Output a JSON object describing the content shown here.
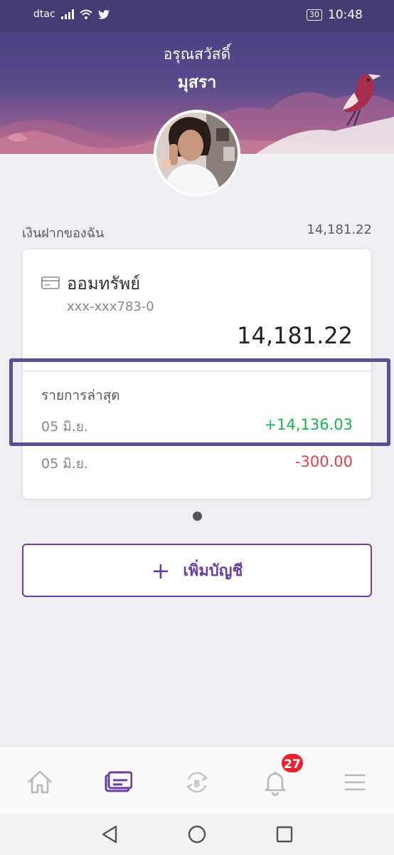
{
  "status_bar": {
    "carrier": "dtac",
    "battery": "30",
    "time": "10:48"
  },
  "header": {
    "greeting": "อรุณสวัสดิ์",
    "name": "มุสรา"
  },
  "deposits": {
    "label": "เงินฝากของฉัน",
    "total": "14,181.22"
  },
  "account": {
    "name": "ออมทรัพย์",
    "number": "xxx-xxx783-0",
    "balance": "14,181.22",
    "recent_label": "รายการล่าสุด",
    "transactions": [
      {
        "date": "05 มิ.ย.",
        "amount": "+14,136.03",
        "type": "credit"
      },
      {
        "date": "05 มิ.ย.",
        "amount": "-300.00",
        "type": "debit"
      }
    ]
  },
  "add_account": {
    "label": "เพิ่มบัญชี",
    "icon": "plus-icon"
  },
  "bottom_nav": {
    "items": [
      {
        "icon": "home-icon"
      },
      {
        "icon": "accounts-card-icon"
      },
      {
        "icon": "transfer-exchange-icon"
      },
      {
        "icon": "notification-bell-icon"
      },
      {
        "icon": "menu-icon"
      }
    ],
    "notification_count": "27"
  },
  "colors": {
    "brand_purple": "#6a3fa0",
    "header_top": "#4c4283",
    "credit": "#20b04f",
    "debit": "#e0434d",
    "highlight_border": "#5b4f96"
  }
}
